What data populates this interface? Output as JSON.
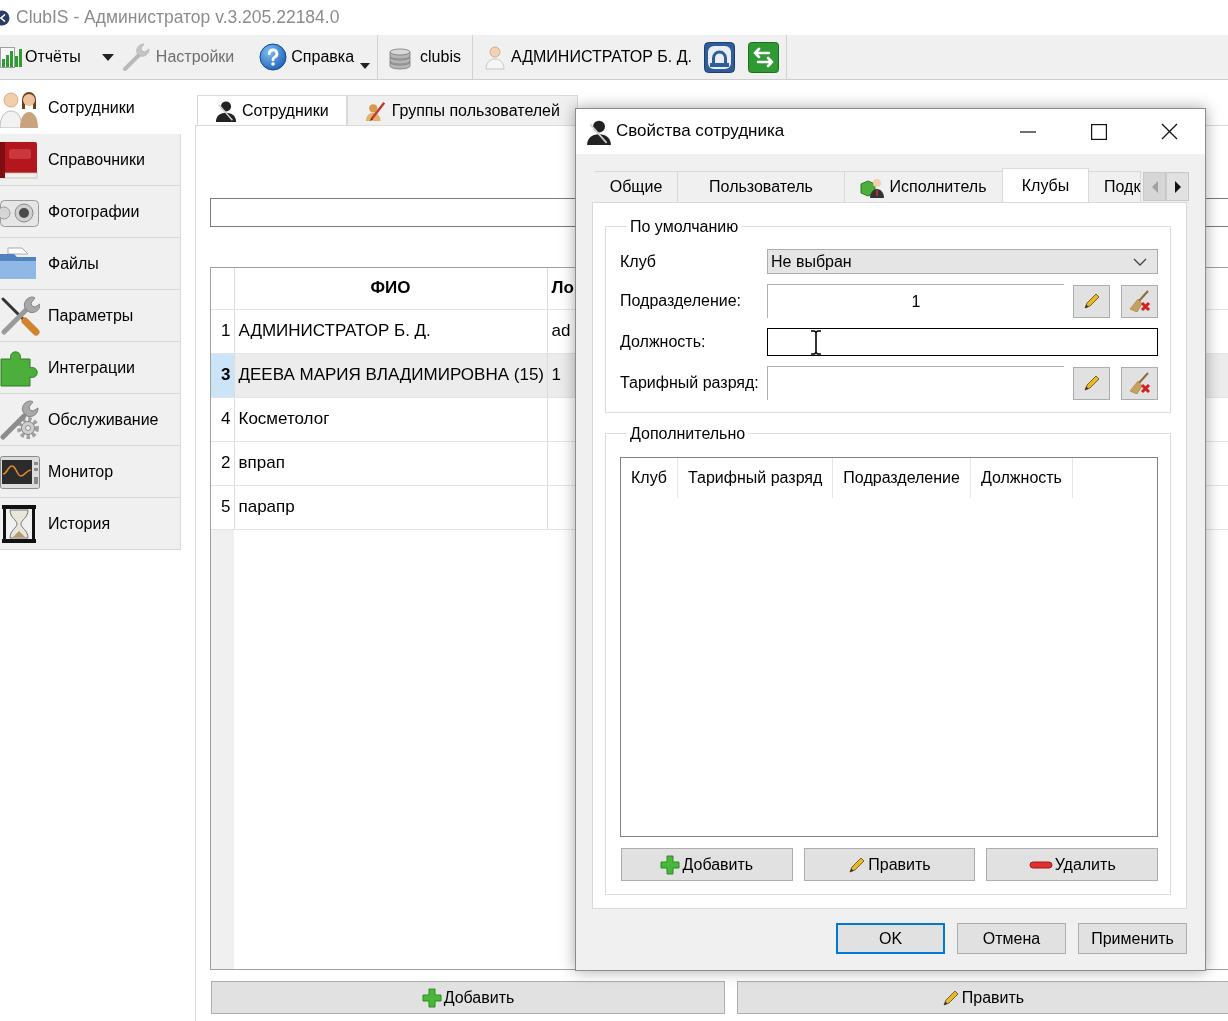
{
  "window": {
    "title": "ClubIS - Администратор v.3.205.22184.0"
  },
  "toolbar": {
    "groups": [
      [
        {
          "kind": "button",
          "label": "Отчёты",
          "disabled": false
        },
        {
          "kind": "arrow",
          "disabled": false
        },
        {
          "kind": "button",
          "label": "Настройки",
          "disabled": true
        },
        {
          "kind": "menu",
          "label": "Справка",
          "disabled": false
        }
      ],
      [
        {
          "kind": "button",
          "label": "clubis",
          "disabled": false
        }
      ],
      [
        {
          "kind": "button",
          "label": "АДМИНИСТРАТОР Б. Д.",
          "disabled": false
        },
        {
          "kind": "icon",
          "disabled": false
        },
        {
          "kind": "icon",
          "disabled": false
        }
      ]
    ]
  },
  "sidebar": {
    "items": [
      {
        "label": "Сотрудники",
        "selected": true
      },
      {
        "label": "Справочники",
        "selected": false
      },
      {
        "label": "Фотографии",
        "selected": false
      },
      {
        "label": "Файлы",
        "selected": false
      },
      {
        "label": "Параметры",
        "selected": false
      },
      {
        "label": "Интеграции",
        "selected": false
      },
      {
        "label": "Обслуживание",
        "selected": false
      },
      {
        "label": "Монитор",
        "selected": false
      },
      {
        "label": "История",
        "selected": false
      }
    ]
  },
  "main_tabs": [
    {
      "label": "Сотрудники",
      "selected": true
    },
    {
      "label": "Группы пользователей",
      "selected": false
    }
  ],
  "table": {
    "columns": [
      "ФИО",
      "Ло"
    ],
    "rows": [
      {
        "number": "1",
        "cells": [
          "АДМИНИСТРАТОР Б. Д.",
          "ad"
        ],
        "selected": false
      },
      {
        "number": "3",
        "cells": [
          "ДЕЕВА МАРИЯ ВЛАДИМИРОВНА (15)",
          "1"
        ],
        "selected": true
      },
      {
        "number": "4",
        "cells": [
          "Косметолог"
        ],
        "selected": false
      },
      {
        "number": "2",
        "cells": [
          "впрап"
        ],
        "selected": false
      },
      {
        "number": "5",
        "cells": [
          "парапр"
        ],
        "selected": false
      }
    ]
  },
  "buttons": [
    "Добавить",
    "Править"
  ],
  "dialog": {
    "title": "Свойства сотрудника",
    "tabs": [
      {
        "label": "Общие",
        "selected": false
      },
      {
        "label": "Пользователь",
        "selected": false
      },
      {
        "label": "Исполнитель",
        "selected": false
      },
      {
        "label": "Клубы",
        "selected": true
      },
      {
        "label": "Подк",
        "selected": false
      }
    ],
    "tab_scroll": [
      {
        "disabled": true
      },
      {
        "disabled": false
      }
    ],
    "defaults": {
      "title": "По умолчанию",
      "fields": [
        {
          "kind": "combo",
          "label": "Клуб",
          "value": "Не выбран",
          "focused": false
        },
        {
          "kind": "picker",
          "label": "Подразделение:",
          "value": "1",
          "focused": false
        },
        {
          "kind": "text",
          "label": "Должность:",
          "focused": true
        },
        {
          "kind": "picker",
          "label": "Тарифный разряд:",
          "focused": false
        }
      ]
    },
    "extra": {
      "title": "Дополнительно",
      "columns": [
        "Клуб",
        "Тарифный разряд",
        "Подразделение",
        "Должность"
      ],
      "buttons": [
        "Добавить",
        "Править",
        "Удалить"
      ]
    },
    "buttons": [
      {
        "label": "OK",
        "default": true
      },
      {
        "label": "Отмена",
        "default": false
      },
      {
        "label": "Применить",
        "default": false
      }
    ]
  }
}
